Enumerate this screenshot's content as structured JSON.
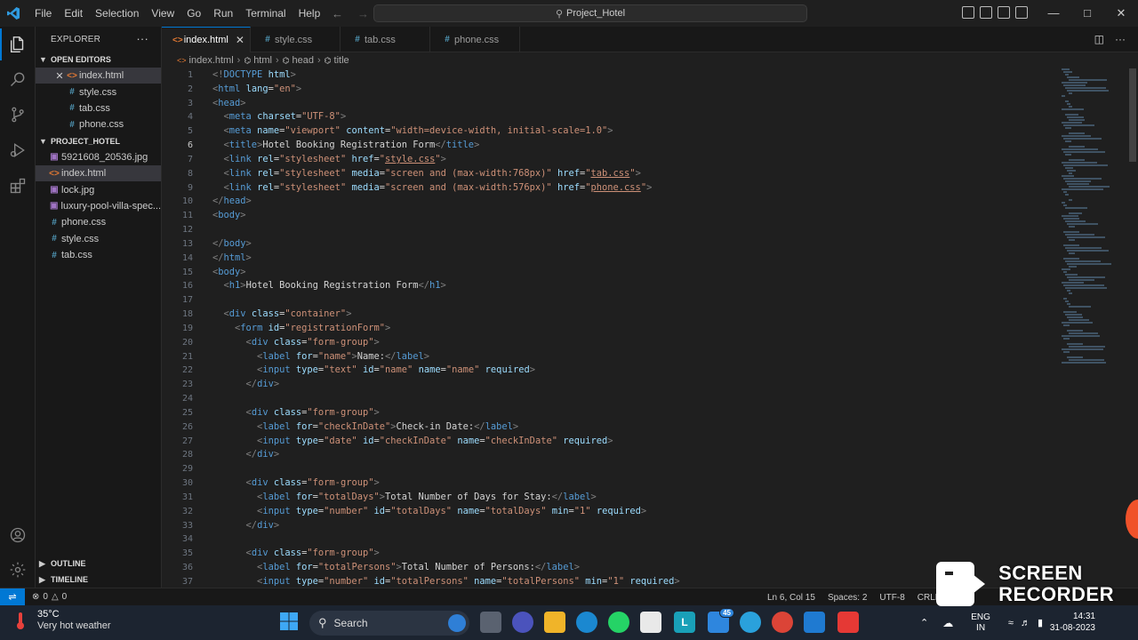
{
  "menu": [
    "File",
    "Edit",
    "Selection",
    "View",
    "Go",
    "Run",
    "Terminal",
    "Help"
  ],
  "command_center": "Project_Hotel",
  "explorer": {
    "title": "EXPLORER",
    "open_editors_label": "OPEN EDITORS",
    "open_editors": [
      {
        "name": "index.html",
        "type": "html"
      },
      {
        "name": "style.css",
        "type": "css"
      },
      {
        "name": "tab.css",
        "type": "css"
      },
      {
        "name": "phone.css",
        "type": "css"
      }
    ],
    "project_label": "PROJECT_HOTEL",
    "files": [
      {
        "name": "5921608_20536.jpg",
        "type": "img"
      },
      {
        "name": "index.html",
        "type": "html"
      },
      {
        "name": "lock.jpg",
        "type": "img"
      },
      {
        "name": "luxury-pool-villa-spec...",
        "type": "img"
      },
      {
        "name": "phone.css",
        "type": "css"
      },
      {
        "name": "style.css",
        "type": "css"
      },
      {
        "name": "tab.css",
        "type": "css"
      }
    ],
    "outline_label": "OUTLINE",
    "timeline_label": "TIMELINE"
  },
  "tabs": [
    {
      "label": "index.html",
      "type": "html",
      "active": true
    },
    {
      "label": "style.css",
      "type": "css",
      "active": false
    },
    {
      "label": "tab.css",
      "type": "css",
      "active": false
    },
    {
      "label": "phone.css",
      "type": "css",
      "active": false
    }
  ],
  "breadcrumb": [
    "index.html",
    "html",
    "head",
    "title"
  ],
  "editor": {
    "current_line": 6,
    "lines": [
      [
        [
          "tg",
          "<!"
        ],
        [
          "tn",
          "DOCTYPE"
        ],
        [
          "tx",
          " "
        ],
        [
          "at",
          "html"
        ],
        [
          "tg",
          ">"
        ]
      ],
      [
        [
          "tg",
          "<"
        ],
        [
          "tn",
          "html"
        ],
        [
          "tx",
          " "
        ],
        [
          "at",
          "lang"
        ],
        [
          "tx",
          "="
        ],
        [
          "st",
          "\"en\""
        ],
        [
          "tg",
          ">"
        ]
      ],
      [
        [
          "tg",
          "<"
        ],
        [
          "tn",
          "head"
        ],
        [
          "tg",
          ">"
        ]
      ],
      [
        [
          "tx",
          "  "
        ],
        [
          "tg",
          "<"
        ],
        [
          "tn",
          "meta"
        ],
        [
          "tx",
          " "
        ],
        [
          "at",
          "charset"
        ],
        [
          "tx",
          "="
        ],
        [
          "st",
          "\"UTF-8\""
        ],
        [
          "tg",
          ">"
        ]
      ],
      [
        [
          "tx",
          "  "
        ],
        [
          "tg",
          "<"
        ],
        [
          "tn",
          "meta"
        ],
        [
          "tx",
          " "
        ],
        [
          "at",
          "name"
        ],
        [
          "tx",
          "="
        ],
        [
          "st",
          "\"viewport\""
        ],
        [
          "tx",
          " "
        ],
        [
          "at",
          "content"
        ],
        [
          "tx",
          "="
        ],
        [
          "st",
          "\"width=device-width, initial-scale=1.0\""
        ],
        [
          "tg",
          ">"
        ]
      ],
      [
        [
          "tx",
          "  "
        ],
        [
          "tg",
          "<"
        ],
        [
          "tn",
          "title"
        ],
        [
          "tg",
          ">"
        ],
        [
          "tx",
          "Hotel Booking Registration Form"
        ],
        [
          "tg",
          "</"
        ],
        [
          "tn",
          "title"
        ],
        [
          "tg",
          ">"
        ]
      ],
      [
        [
          "tx",
          "  "
        ],
        [
          "tg",
          "<"
        ],
        [
          "tn",
          "link"
        ],
        [
          "tx",
          " "
        ],
        [
          "at",
          "rel"
        ],
        [
          "tx",
          "="
        ],
        [
          "st",
          "\"stylesheet\""
        ],
        [
          "tx",
          " "
        ],
        [
          "at",
          "href"
        ],
        [
          "tx",
          "="
        ],
        [
          "st",
          "\""
        ],
        [
          "stl",
          "style.css"
        ],
        [
          "st",
          "\""
        ],
        [
          "tg",
          ">"
        ]
      ],
      [
        [
          "tx",
          "  "
        ],
        [
          "tg",
          "<"
        ],
        [
          "tn",
          "link"
        ],
        [
          "tx",
          " "
        ],
        [
          "at",
          "rel"
        ],
        [
          "tx",
          "="
        ],
        [
          "st",
          "\"stylesheet\""
        ],
        [
          "tx",
          " "
        ],
        [
          "at",
          "media"
        ],
        [
          "tx",
          "="
        ],
        [
          "st",
          "\"screen and (max-width:768px)\""
        ],
        [
          "tx",
          " "
        ],
        [
          "at",
          "href"
        ],
        [
          "tx",
          "="
        ],
        [
          "st",
          "\""
        ],
        [
          "stl",
          "tab.css"
        ],
        [
          "st",
          "\""
        ],
        [
          "tg",
          ">"
        ]
      ],
      [
        [
          "tx",
          "  "
        ],
        [
          "tg",
          "<"
        ],
        [
          "tn",
          "link"
        ],
        [
          "tx",
          " "
        ],
        [
          "at",
          "rel"
        ],
        [
          "tx",
          "="
        ],
        [
          "st",
          "\"stylesheet\""
        ],
        [
          "tx",
          " "
        ],
        [
          "at",
          "media"
        ],
        [
          "tx",
          "="
        ],
        [
          "st",
          "\"screen and (max-width:576px)\""
        ],
        [
          "tx",
          " "
        ],
        [
          "at",
          "href"
        ],
        [
          "tx",
          "="
        ],
        [
          "st",
          "\""
        ],
        [
          "stl",
          "phone.css"
        ],
        [
          "st",
          "\""
        ],
        [
          "tg",
          ">"
        ]
      ],
      [
        [
          "tg",
          "</"
        ],
        [
          "tn",
          "head"
        ],
        [
          "tg",
          ">"
        ]
      ],
      [
        [
          "tg",
          "<"
        ],
        [
          "tn",
          "body"
        ],
        [
          "tg",
          ">"
        ]
      ],
      [],
      [
        [
          "tg",
          "</"
        ],
        [
          "tn",
          "body"
        ],
        [
          "tg",
          ">"
        ]
      ],
      [
        [
          "tg",
          "</"
        ],
        [
          "tn",
          "html"
        ],
        [
          "tg",
          ">"
        ]
      ],
      [
        [
          "tg",
          "<"
        ],
        [
          "tn",
          "body"
        ],
        [
          "tg",
          ">"
        ]
      ],
      [
        [
          "tx",
          "  "
        ],
        [
          "tg",
          "<"
        ],
        [
          "tn",
          "h1"
        ],
        [
          "tg",
          ">"
        ],
        [
          "tx",
          "Hotel Booking Registration Form"
        ],
        [
          "tg",
          "</"
        ],
        [
          "tn",
          "h1"
        ],
        [
          "tg",
          ">"
        ]
      ],
      [],
      [
        [
          "tx",
          "  "
        ],
        [
          "tg",
          "<"
        ],
        [
          "tn",
          "div"
        ],
        [
          "tx",
          " "
        ],
        [
          "at",
          "class"
        ],
        [
          "tx",
          "="
        ],
        [
          "st",
          "\"container\""
        ],
        [
          "tg",
          ">"
        ]
      ],
      [
        [
          "tx",
          "    "
        ],
        [
          "tg",
          "<"
        ],
        [
          "tn",
          "form"
        ],
        [
          "tx",
          " "
        ],
        [
          "at",
          "id"
        ],
        [
          "tx",
          "="
        ],
        [
          "st",
          "\"registrationForm\""
        ],
        [
          "tg",
          ">"
        ]
      ],
      [
        [
          "tx",
          "      "
        ],
        [
          "tg",
          "<"
        ],
        [
          "tn",
          "div"
        ],
        [
          "tx",
          " "
        ],
        [
          "at",
          "class"
        ],
        [
          "tx",
          "="
        ],
        [
          "st",
          "\"form-group\""
        ],
        [
          "tg",
          ">"
        ]
      ],
      [
        [
          "tx",
          "        "
        ],
        [
          "tg",
          "<"
        ],
        [
          "tn",
          "label"
        ],
        [
          "tx",
          " "
        ],
        [
          "at",
          "for"
        ],
        [
          "tx",
          "="
        ],
        [
          "st",
          "\"name\""
        ],
        [
          "tg",
          ">"
        ],
        [
          "tx",
          "Name:"
        ],
        [
          "tg",
          "</"
        ],
        [
          "tn",
          "label"
        ],
        [
          "tg",
          ">"
        ]
      ],
      [
        [
          "tx",
          "        "
        ],
        [
          "tg",
          "<"
        ],
        [
          "tn",
          "input"
        ],
        [
          "tx",
          " "
        ],
        [
          "at",
          "type"
        ],
        [
          "tx",
          "="
        ],
        [
          "st",
          "\"text\""
        ],
        [
          "tx",
          " "
        ],
        [
          "at",
          "id"
        ],
        [
          "tx",
          "="
        ],
        [
          "st",
          "\"name\""
        ],
        [
          "tx",
          " "
        ],
        [
          "at",
          "name"
        ],
        [
          "tx",
          "="
        ],
        [
          "st",
          "\"name\""
        ],
        [
          "tx",
          " "
        ],
        [
          "at",
          "required"
        ],
        [
          "tg",
          ">"
        ]
      ],
      [
        [
          "tx",
          "      "
        ],
        [
          "tg",
          "</"
        ],
        [
          "tn",
          "div"
        ],
        [
          "tg",
          ">"
        ]
      ],
      [],
      [
        [
          "tx",
          "      "
        ],
        [
          "tg",
          "<"
        ],
        [
          "tn",
          "div"
        ],
        [
          "tx",
          " "
        ],
        [
          "at",
          "class"
        ],
        [
          "tx",
          "="
        ],
        [
          "st",
          "\"form-group\""
        ],
        [
          "tg",
          ">"
        ]
      ],
      [
        [
          "tx",
          "        "
        ],
        [
          "tg",
          "<"
        ],
        [
          "tn",
          "label"
        ],
        [
          "tx",
          " "
        ],
        [
          "at",
          "for"
        ],
        [
          "tx",
          "="
        ],
        [
          "st",
          "\"checkInDate\""
        ],
        [
          "tg",
          ">"
        ],
        [
          "tx",
          "Check-in Date:"
        ],
        [
          "tg",
          "</"
        ],
        [
          "tn",
          "label"
        ],
        [
          "tg",
          ">"
        ]
      ],
      [
        [
          "tx",
          "        "
        ],
        [
          "tg",
          "<"
        ],
        [
          "tn",
          "input"
        ],
        [
          "tx",
          " "
        ],
        [
          "at",
          "type"
        ],
        [
          "tx",
          "="
        ],
        [
          "st",
          "\"date\""
        ],
        [
          "tx",
          " "
        ],
        [
          "at",
          "id"
        ],
        [
          "tx",
          "="
        ],
        [
          "st",
          "\"checkInDate\""
        ],
        [
          "tx",
          " "
        ],
        [
          "at",
          "name"
        ],
        [
          "tx",
          "="
        ],
        [
          "st",
          "\"checkInDate\""
        ],
        [
          "tx",
          " "
        ],
        [
          "at",
          "required"
        ],
        [
          "tg",
          ">"
        ]
      ],
      [
        [
          "tx",
          "      "
        ],
        [
          "tg",
          "</"
        ],
        [
          "tn",
          "div"
        ],
        [
          "tg",
          ">"
        ]
      ],
      [],
      [
        [
          "tx",
          "      "
        ],
        [
          "tg",
          "<"
        ],
        [
          "tn",
          "div"
        ],
        [
          "tx",
          " "
        ],
        [
          "at",
          "class"
        ],
        [
          "tx",
          "="
        ],
        [
          "st",
          "\"form-group\""
        ],
        [
          "tg",
          ">"
        ]
      ],
      [
        [
          "tx",
          "        "
        ],
        [
          "tg",
          "<"
        ],
        [
          "tn",
          "label"
        ],
        [
          "tx",
          " "
        ],
        [
          "at",
          "for"
        ],
        [
          "tx",
          "="
        ],
        [
          "st",
          "\"totalDays\""
        ],
        [
          "tg",
          ">"
        ],
        [
          "tx",
          "Total Number of Days for Stay:"
        ],
        [
          "tg",
          "</"
        ],
        [
          "tn",
          "label"
        ],
        [
          "tg",
          ">"
        ]
      ],
      [
        [
          "tx",
          "        "
        ],
        [
          "tg",
          "<"
        ],
        [
          "tn",
          "input"
        ],
        [
          "tx",
          " "
        ],
        [
          "at",
          "type"
        ],
        [
          "tx",
          "="
        ],
        [
          "st",
          "\"number\""
        ],
        [
          "tx",
          " "
        ],
        [
          "at",
          "id"
        ],
        [
          "tx",
          "="
        ],
        [
          "st",
          "\"totalDays\""
        ],
        [
          "tx",
          " "
        ],
        [
          "at",
          "name"
        ],
        [
          "tx",
          "="
        ],
        [
          "st",
          "\"totalDays\""
        ],
        [
          "tx",
          " "
        ],
        [
          "at",
          "min"
        ],
        [
          "tx",
          "="
        ],
        [
          "st",
          "\"1\""
        ],
        [
          "tx",
          " "
        ],
        [
          "at",
          "required"
        ],
        [
          "tg",
          ">"
        ]
      ],
      [
        [
          "tx",
          "      "
        ],
        [
          "tg",
          "</"
        ],
        [
          "tn",
          "div"
        ],
        [
          "tg",
          ">"
        ]
      ],
      [],
      [
        [
          "tx",
          "      "
        ],
        [
          "tg",
          "<"
        ],
        [
          "tn",
          "div"
        ],
        [
          "tx",
          " "
        ],
        [
          "at",
          "class"
        ],
        [
          "tx",
          "="
        ],
        [
          "st",
          "\"form-group\""
        ],
        [
          "tg",
          ">"
        ]
      ],
      [
        [
          "tx",
          "        "
        ],
        [
          "tg",
          "<"
        ],
        [
          "tn",
          "label"
        ],
        [
          "tx",
          " "
        ],
        [
          "at",
          "for"
        ],
        [
          "tx",
          "="
        ],
        [
          "st",
          "\"totalPersons\""
        ],
        [
          "tg",
          ">"
        ],
        [
          "tx",
          "Total Number of Persons:"
        ],
        [
          "tg",
          "</"
        ],
        [
          "tn",
          "label"
        ],
        [
          "tg",
          ">"
        ]
      ],
      [
        [
          "tx",
          "        "
        ],
        [
          "tg",
          "<"
        ],
        [
          "tn",
          "input"
        ],
        [
          "tx",
          " "
        ],
        [
          "at",
          "type"
        ],
        [
          "tx",
          "="
        ],
        [
          "st",
          "\"number\""
        ],
        [
          "tx",
          " "
        ],
        [
          "at",
          "id"
        ],
        [
          "tx",
          "="
        ],
        [
          "st",
          "\"totalPersons\""
        ],
        [
          "tx",
          " "
        ],
        [
          "at",
          "name"
        ],
        [
          "tx",
          "="
        ],
        [
          "st",
          "\"totalPersons\""
        ],
        [
          "tx",
          " "
        ],
        [
          "at",
          "min"
        ],
        [
          "tx",
          "="
        ],
        [
          "st",
          "\"1\""
        ],
        [
          "tx",
          " "
        ],
        [
          "at",
          "required"
        ],
        [
          "tg",
          ">"
        ]
      ]
    ]
  },
  "status": {
    "errors": "0",
    "warnings": "0",
    "position": "Ln 6, Col 15",
    "spaces": "Spaces: 2",
    "encoding": "UTF-8",
    "eol": "CRLF"
  },
  "taskbar": {
    "temperature": "35°C",
    "weather": "Very hot weather",
    "search_label": "Search",
    "mail_badge": "45",
    "lang_top": "ENG",
    "lang_bottom": "IN",
    "time": "14:31",
    "date": "31-08-2023"
  },
  "watermark": {
    "line1": "SCREEN",
    "line2": "RECORDER"
  },
  "colors": {
    "accent": "#0078d4",
    "html_icon": "#e37933",
    "css_icon": "#519aba",
    "img_icon": "#a074c4"
  }
}
